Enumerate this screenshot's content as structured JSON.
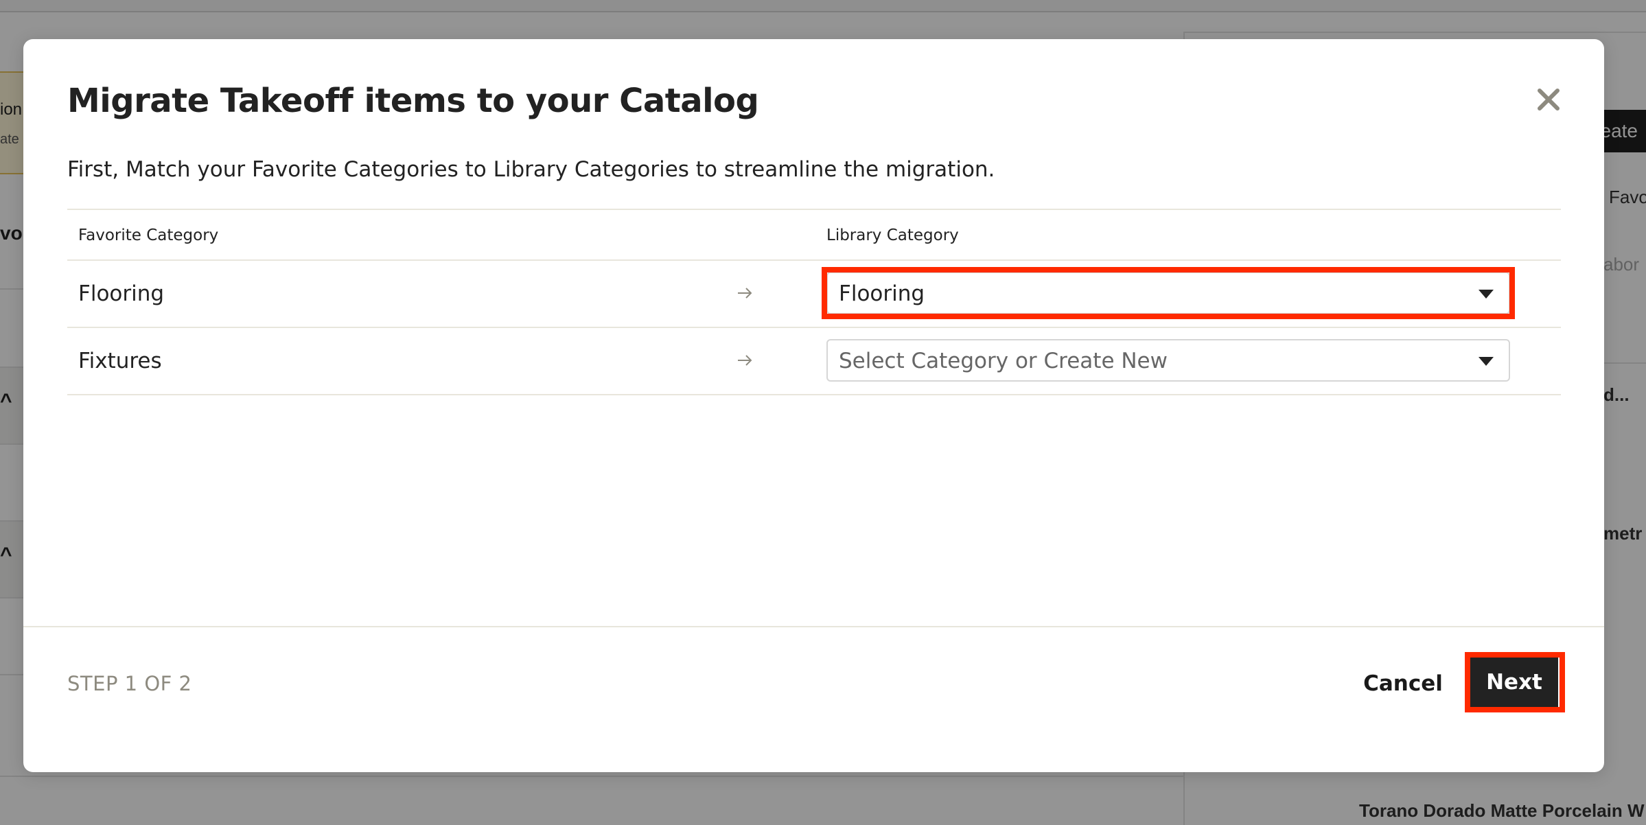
{
  "background": {
    "left_fragments": [
      "ion",
      "ate",
      "vo"
    ],
    "right_fragments": [
      "eate",
      "Favo",
      "abor",
      "d...",
      "metr",
      "Torano Dorado Matte Porcelain W"
    ]
  },
  "modal": {
    "title": "Migrate Takeoff items to your Catalog",
    "description": "First, Match your Favorite Categories to Library Categories to streamline the migration.",
    "close_icon": "close-icon",
    "table": {
      "headers": {
        "favorite": "Favorite Category",
        "library": "Library Category"
      },
      "rows": [
        {
          "favorite": "Flooring",
          "arrow_icon": "arrow-right-icon",
          "library_value": "Flooring",
          "is_placeholder": false
        },
        {
          "favorite": "Fixtures",
          "arrow_icon": "arrow-right-icon",
          "library_value": "Select Category or Create New",
          "is_placeholder": true
        }
      ]
    },
    "footer": {
      "step": "STEP 1 OF 2",
      "cancel_label": "Cancel",
      "next_label": "Next"
    }
  },
  "colors": {
    "highlight": "#ff2a00",
    "primary_button": "#222222",
    "step_text": "#8d8a7f",
    "divider": "#e8e6dc"
  }
}
